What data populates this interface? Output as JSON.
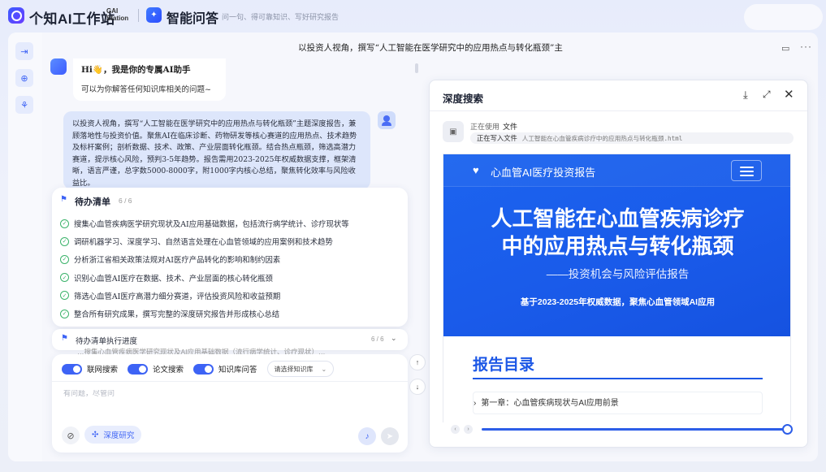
{
  "app": {
    "brand": "个知AI工作站",
    "brand_sub_1": "GAI",
    "brand_sub_2": "Station",
    "section_title": "智能问答",
    "slogan": "问一句、得可靠知识、写好研究报告"
  },
  "chat": {
    "header_title": "以投资人视角，撰写“人工智能在医学研究中的应用热点与转化瓶颈”主",
    "bot_greeting_prefix": "Hi",
    "bot_greeting_emoji": "👋",
    "bot_greeting_text": "，我是你的专属AI助手",
    "bot_subtext": "可以为你解答任何知识库相关的问题~",
    "user_message": "以投资人视角，撰写“人工智能在医学研究中的应用热点与转化瓶颈”主题深度报告，兼顾落地性与投资价值。聚焦AI在临床诊断、药物研发等核心赛道的应用热点、技术趋势及标杆案例；剖析数据、技术、政策、产业层面转化瓶颈。结合热点瓶颈，筛选高潜力赛道，提示核心风险，预判3-5年趋势。报告需用2023-2025年权威数据支撑，框架清晰，语言严谨，总字数5000-8000字，附1000字内核心总结，聚焦转化效率与风险收益比。"
  },
  "todo": {
    "title": "待办清单",
    "count": "6 / 6",
    "items": [
      "搜集心血管疾病医学研究现状及AI应用基础数据，包括流行病学统计、诊疗现状等",
      "调研机器学习、深度学习、自然语言处理在心血管领域的应用案例和技术趋势",
      "分析浙江省相关政策法规对AI医疗产品转化的影响和制约因素",
      "识别心血管AI医疗在数据、技术、产业层面的核心转化瓶颈",
      "筛选心血管AI医疗高潜力细分赛道，评估投资风险和收益预期",
      "整合所有研究成果，撰写完整的深度研究报告并形成核心总结"
    ]
  },
  "progress": {
    "label": "待办清单执行进度",
    "count": "6 / 6"
  },
  "behind_text": "…搜集心血管疾病医学研究现状及AI应用基础数据（流行病学统计、诊疗现状）…",
  "input": {
    "toggle_web": "联网搜索",
    "toggle_paper": "论文搜索",
    "toggle_kb": "知识库问答",
    "kb_select": "请选择知识库",
    "placeholder": "有问题，尽管问",
    "deep_research": "深度研究"
  },
  "panel": {
    "title": "深度搜索",
    "tool_using_label": "正在使用",
    "tool_using_value": "文件",
    "tool_writing_label": "正在写入文件",
    "tool_writing_file": "人工智能在心血管疾病诊疗中的应用热点与转化瓶颈.html"
  },
  "preview": {
    "nav_brand": "心血管AI医疗投资报告",
    "h1_line1": "人工智能在心血管疾病诊疗",
    "h1_line2": "中的应用热点与转化瓶颈",
    "h2": "——投资机会与风险评估报告",
    "desc": "基于2023-2025年权威数据，聚焦心血管领域AI应用",
    "toc_title": "报告目录",
    "chapter1": "第一章：心血管疾病现状与AI应用前景"
  },
  "colors": {
    "accent": "#3d63f5",
    "hero_blue": "#1a5bea",
    "check_green": "#3bb36a"
  }
}
